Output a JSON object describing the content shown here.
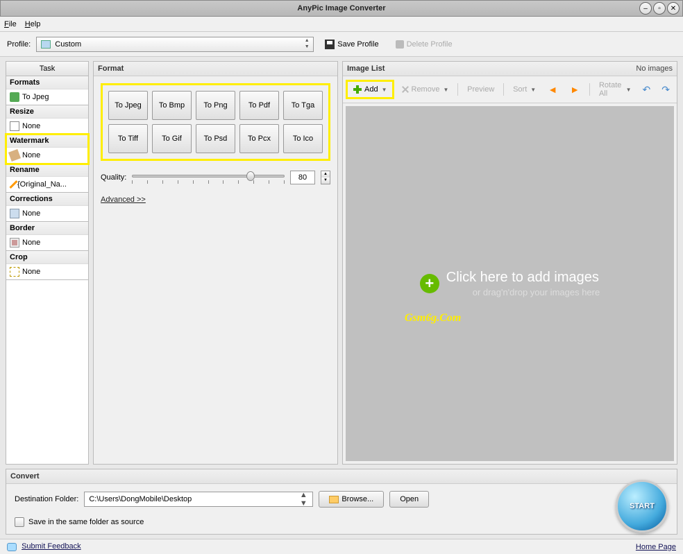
{
  "window": {
    "title": "AnyPic Image Converter"
  },
  "menubar": {
    "file": "File",
    "help": "Help"
  },
  "profile": {
    "label": "Profile:",
    "selected": "Custom",
    "save": "Save Profile",
    "delete": "Delete Profile"
  },
  "sidebar": {
    "task_header": "Task",
    "groups": {
      "formats": {
        "header": "Formats",
        "item": "To Jpeg"
      },
      "resize": {
        "header": "Resize",
        "item": "None"
      },
      "watermark": {
        "header": "Watermark",
        "item": "None"
      },
      "rename": {
        "header": "Rename",
        "item": "{Original_Na..."
      },
      "corrections": {
        "header": "Corrections",
        "item": "None"
      },
      "border": {
        "header": "Border",
        "item": "None"
      },
      "crop": {
        "header": "Crop",
        "item": "None"
      }
    }
  },
  "format": {
    "header": "Format",
    "buttons": [
      "To Jpeg",
      "To Bmp",
      "To Png",
      "To Pdf",
      "To Tga",
      "To Tiff",
      "To Gif",
      "To Psd",
      "To Pcx",
      "To Ico"
    ],
    "quality_label": "Quality:",
    "quality_value": "80",
    "advanced": "Advanced >>"
  },
  "imagelist": {
    "header": "Image List",
    "status": "No images",
    "toolbar": {
      "add": "Add",
      "remove": "Remove",
      "preview": "Preview",
      "sort": "Sort",
      "rotate": "Rotate All"
    },
    "drop": {
      "line1": "Click here  to add images",
      "line2": "or drag'n'drop your images here"
    },
    "watermark_overlay": "Gsm6g.Com"
  },
  "convert": {
    "header": "Convert",
    "dest_label": "Destination Folder:",
    "dest_value": "C:\\Users\\DongMobile\\Desktop",
    "browse": "Browse...",
    "open": "Open",
    "same_folder": "Save in the same folder as source",
    "start": "START"
  },
  "footer": {
    "feedback": "Submit Feedback",
    "home": "Home Page"
  }
}
